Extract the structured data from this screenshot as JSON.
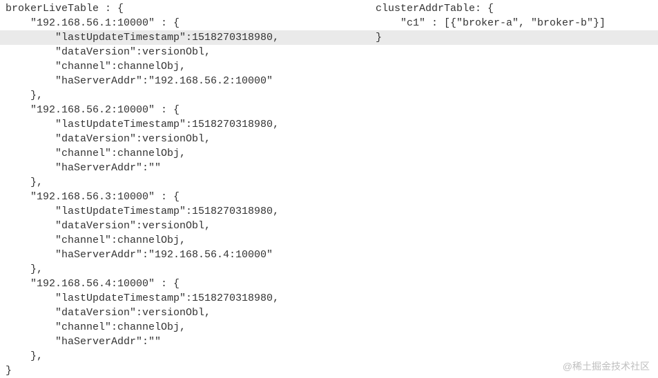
{
  "left": {
    "l01": "brokerLiveTable : {",
    "l02": "    \"192.168.56.1:10000\" : {",
    "l03": "        \"lastUpdateTimestamp\":1518270318980,",
    "l04": "        \"dataVersion\":versionObl,",
    "l05": "        \"channel\":channelObj,",
    "l06": "        \"haServerAddr\":\"192.168.56.2:10000\"",
    "l07": "    },",
    "l08": "    \"192.168.56.2:10000\" : {",
    "l09": "        \"lastUpdateTimestamp\":1518270318980,",
    "l10": "        \"dataVersion\":versionObl,",
    "l11": "        \"channel\":channelObj,",
    "l12": "        \"haServerAddr\":\"\"",
    "l13": "    },",
    "l14": "    \"192.168.56.3:10000\" : {",
    "l15": "        \"lastUpdateTimestamp\":1518270318980,",
    "l16": "        \"dataVersion\":versionObl,",
    "l17": "        \"channel\":channelObj,",
    "l18": "        \"haServerAddr\":\"192.168.56.4:10000\"",
    "l19": "    },",
    "l20": "    \"192.168.56.4:10000\" : {",
    "l21": "        \"lastUpdateTimestamp\":1518270318980,",
    "l22": "        \"dataVersion\":versionObl,",
    "l23": "        \"channel\":channelObj,",
    "l24": "        \"haServerAddr\":\"\"",
    "l25": "    },",
    "l26": "}"
  },
  "right": {
    "r01": "clusterAddrTable: {",
    "r02": "    \"c1\" : [{\"broker-a\", \"broker-b\"}]",
    "r03": "}"
  },
  "watermark": "@稀土掘金技术社区"
}
